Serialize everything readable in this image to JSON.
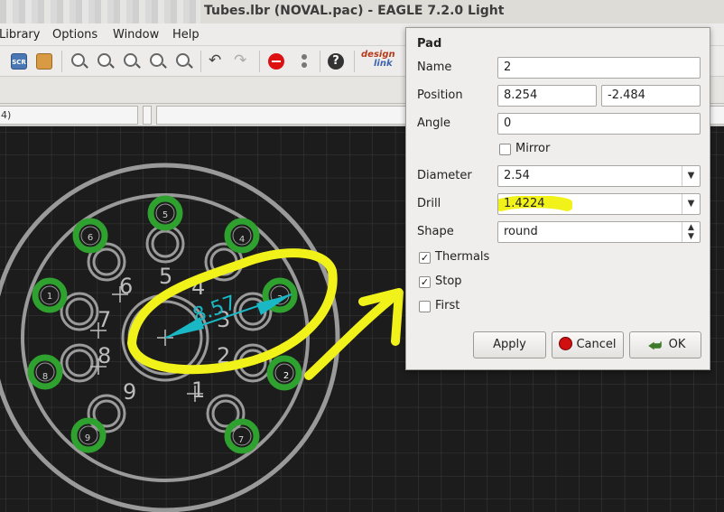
{
  "window": {
    "title": "Tubes.lbr (NOVAL.pac) - EAGLE 7.2.0 Light"
  },
  "menu": [
    {
      "key": "library",
      "label": "Library"
    },
    {
      "key": "options",
      "label": "Options"
    },
    {
      "key": "window",
      "label": "Window"
    },
    {
      "key": "help",
      "label": "Help"
    }
  ],
  "toolbar": {
    "scr_label": "SCR",
    "designlink_top": "design",
    "designlink_bottom": "link"
  },
  "status": {
    "left_field": "4)"
  },
  "canvas": {
    "pad_numbers": [
      "5",
      "6",
      "4",
      "1",
      "3",
      "2",
      "8",
      "9",
      "7"
    ],
    "body_labels": [
      "6",
      "5",
      "4",
      "7",
      "3",
      "8",
      "2",
      "9",
      "1"
    ],
    "dimension_label": "8.57",
    "colors": {
      "background": "#1c1c1c",
      "grid": "#3a3a3a",
      "outline": "#9a9a9a",
      "pad": "#2fa12f",
      "dimension": "#19b8c4",
      "highlight": "#f2f21b",
      "selected_pad_label": "#ffffff"
    }
  },
  "dialog": {
    "title": "Pad",
    "name_label": "Name",
    "name_value": "2",
    "position_label": "Position",
    "position_x": "8.254",
    "position_y": "-2.484",
    "angle_label": "Angle",
    "angle_value": "0",
    "mirror_label": "Mirror",
    "mirror_checked": false,
    "diameter_label": "Diameter",
    "diameter_value": "2.54",
    "drill_label": "Drill",
    "drill_value": "1.4224",
    "shape_label": "Shape",
    "shape_value": "round",
    "thermals_label": "Thermals",
    "thermals_checked": true,
    "stop_label": "Stop",
    "stop_checked": true,
    "first_label": "First",
    "first_checked": false,
    "apply_label": "Apply",
    "cancel_label": "Cancel",
    "ok_label": "OK",
    "check_glyph": "✓"
  }
}
